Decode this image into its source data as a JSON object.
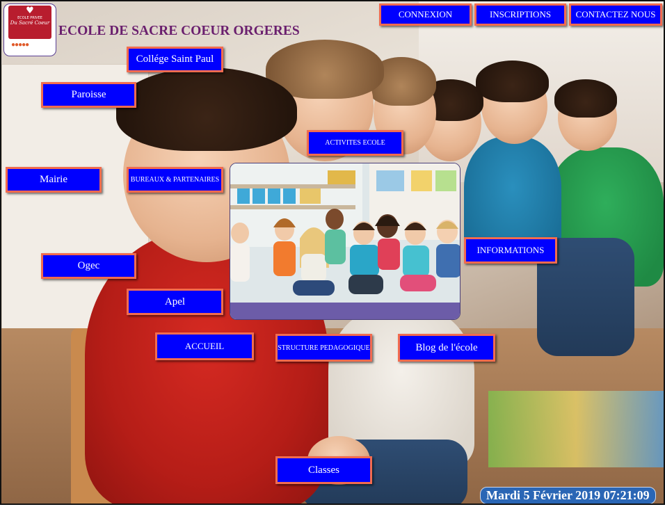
{
  "logo": {
    "line1": "ECOLE PRIVEE",
    "line2": "Du Sacré Coeur",
    "line3": "maternelle et élémentaire"
  },
  "header": {
    "title": "ECOLE DE SACRE COEUR ORGERES"
  },
  "top_nav": {
    "connexion": "CONNEXION",
    "inscriptions": "INSCRIPTIONS",
    "contact": "CONTACTEZ NOUS"
  },
  "links": {
    "college": "Collége Saint Paul",
    "paroisse": "Paroisse",
    "activites": "ACTIVITES ECOLE",
    "mairie": "Mairie",
    "bureaux": "BUREAUX & PARTENAIRES",
    "informations": "INFORMATIONS",
    "ogec": "Ogec",
    "apel": "Apel",
    "accueil": "ACCUEIL",
    "structure": "STRUCTURE PEDAGOGIQUE",
    "blog": "Blog de l'école",
    "classes": "Classes"
  },
  "status": {
    "datetime": "Mardi 5 Février 2019 07:21:09"
  },
  "colors": {
    "button_bg": "#0000ff",
    "button_border": "#f26b4f",
    "title": "#6a1f6e",
    "clock_bg": "#2a66b5"
  }
}
